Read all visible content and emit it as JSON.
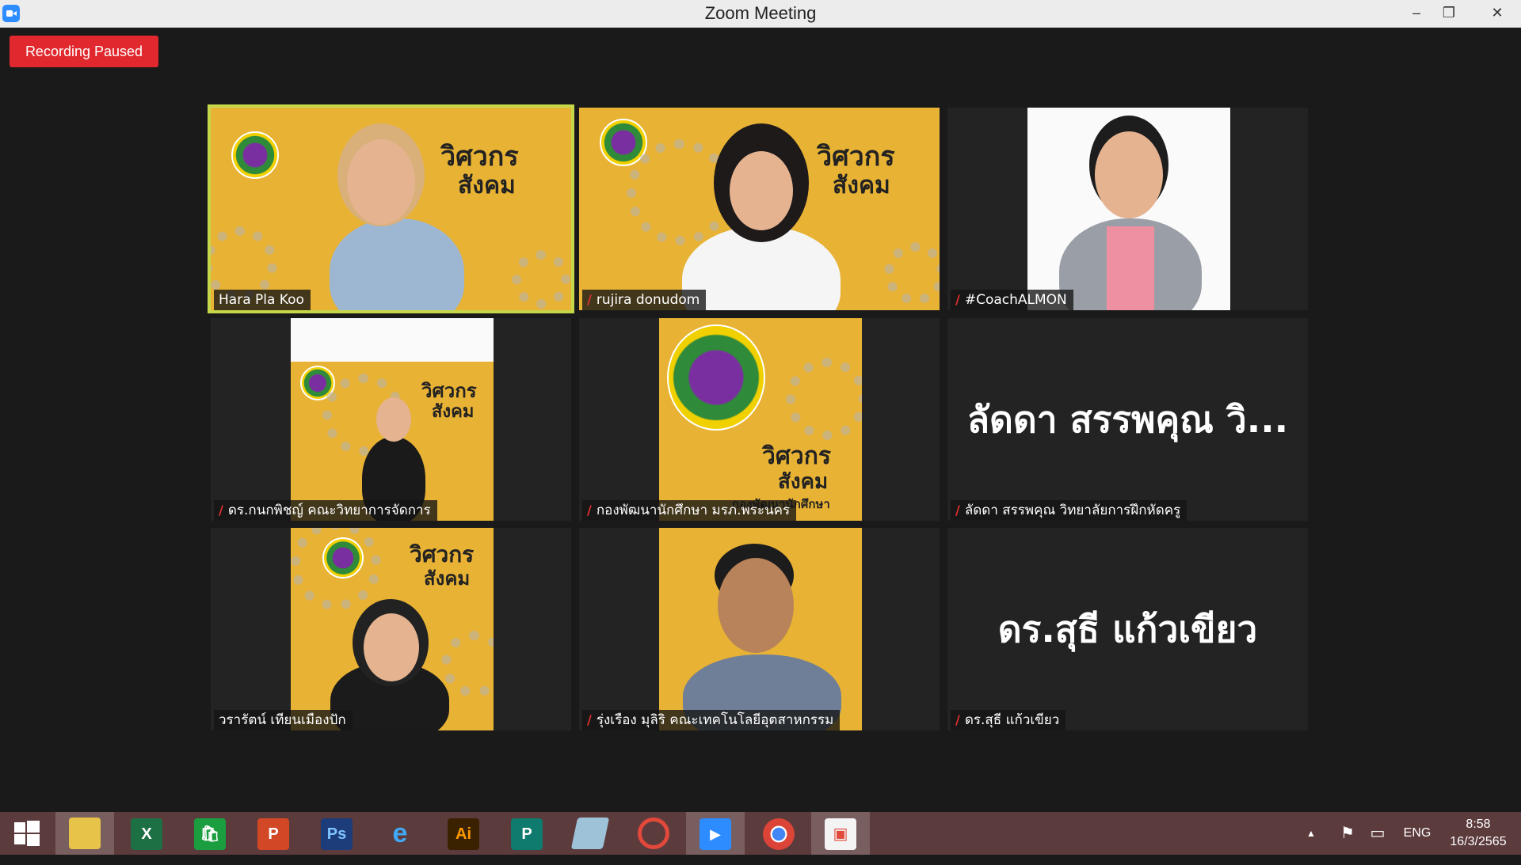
{
  "window": {
    "title": "Zoom Meeting",
    "minimize_glyph": "–",
    "maximize_glyph": "❐",
    "close_glyph": "✕"
  },
  "recording": {
    "label": "Recording Paused"
  },
  "participants": [
    {
      "name": "Hara Pla Koo",
      "muted": false,
      "active": true
    },
    {
      "name": "rujira donudom",
      "muted": true
    },
    {
      "name": "#CoachALMON",
      "muted": true
    },
    {
      "name": "ดร.กนกพิชญ์ คณะวิทยาการจัดการ",
      "muted": true
    },
    {
      "name": "กองพัฒนานักศึกษา มรภ.พระนคร",
      "muted": true
    },
    {
      "name": "ลัดดา สรรพคุณ วิทยาลัยการฝึกหัดครู",
      "muted": true,
      "display_text": "ลัดดา สรรพคุณ วิ..."
    },
    {
      "name": "วรารัตน์ เทียนเมืองปัก",
      "muted": false
    },
    {
      "name": "รุ่งเรือง มุลิริ คณะเทคโนโลยีอุตสาหกรรม",
      "muted": true
    },
    {
      "name": "ดร.สุธี  แก้วเขียว",
      "muted": true,
      "display_text": "ดร.สุธี  แก้วเขียว"
    }
  ],
  "banner": {
    "line1": "วิศวกร",
    "line2": "สังคม",
    "org": "กองพัฒนานักศึกษา"
  },
  "taskbar": {
    "apps": [
      "windows-start",
      "file-explorer",
      "excel",
      "store",
      "powerpoint",
      "photoshop",
      "internet-explorer",
      "illustrator",
      "publisher",
      "notepad",
      "photoscape",
      "zoom",
      "chrome",
      "image-viewer"
    ],
    "labels": {
      "excel": "X",
      "store": "🛍",
      "powerpoint": "P",
      "photoshop": "Ps",
      "ie": "e",
      "illustrator": "Ai",
      "publisher": "P",
      "zoom": "▶",
      "chrome": "●",
      "viewer": "▣"
    },
    "colors": {
      "bar": "#5c3b3d",
      "excel": "#1d7044",
      "store": "#1a9e3f",
      "powerpoint": "#d24726",
      "photoshop": "#1c3c7a",
      "illustrator": "#ff9a00",
      "publisher": "#0f7a6e",
      "zoom": "#2d8cff"
    },
    "tray": {
      "up_arrow": "▲",
      "flag": "⚑",
      "network": "▭",
      "language": "ENG",
      "time": "8:58",
      "date": "16/3/2565"
    }
  }
}
